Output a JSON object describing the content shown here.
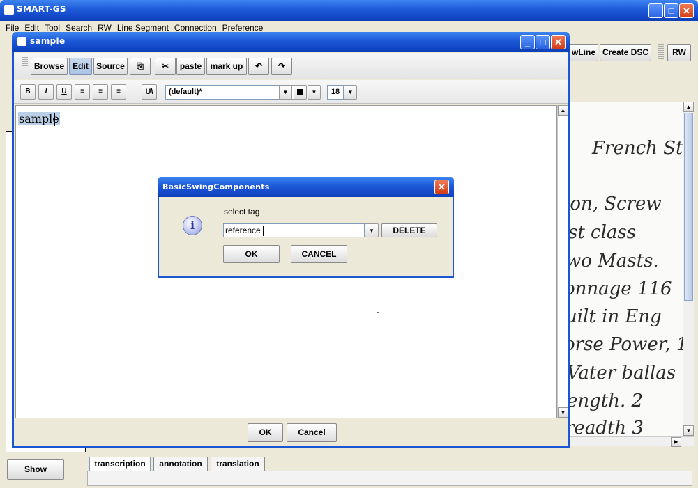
{
  "main_window": {
    "title": "SMART-GS",
    "menu": [
      "File",
      "Edit",
      "Tool",
      "Search",
      "RW",
      "Line Segment",
      "Connection",
      "Preference"
    ],
    "toolbar_right": [
      "wLine",
      "Create DSC",
      "RW"
    ]
  },
  "sample_window": {
    "title": "sample",
    "toolbar": {
      "browse": "Browse",
      "edit": "Edit",
      "source": "Source",
      "paste": "paste",
      "markup": "mark up"
    },
    "format_bar": {
      "bold": "B",
      "italic": "I",
      "underline": "U",
      "unicode": "U\\",
      "style_value": "(default)*",
      "font_size": "18"
    },
    "editor_text": "sample",
    "ok": "OK",
    "cancel": "Cancel"
  },
  "dialog": {
    "title": "BasicSwingComponents",
    "prompt": "select tag",
    "tag_value": "reference",
    "delete": "DELETE",
    "ok": "OK",
    "cancel": "CANCEL"
  },
  "bottom": {
    "show": "Show",
    "tabs": [
      "transcription",
      "annotation",
      "translation"
    ]
  },
  "manuscript_lines": [
    "French Ste",
    "ion, Screw",
    "st class",
    "wo Masts.",
    "onnage 116",
    "uilt in Eng",
    "orse Power, 1",
    "Vater ballas",
    "ength. 2",
    "readth 3"
  ]
}
